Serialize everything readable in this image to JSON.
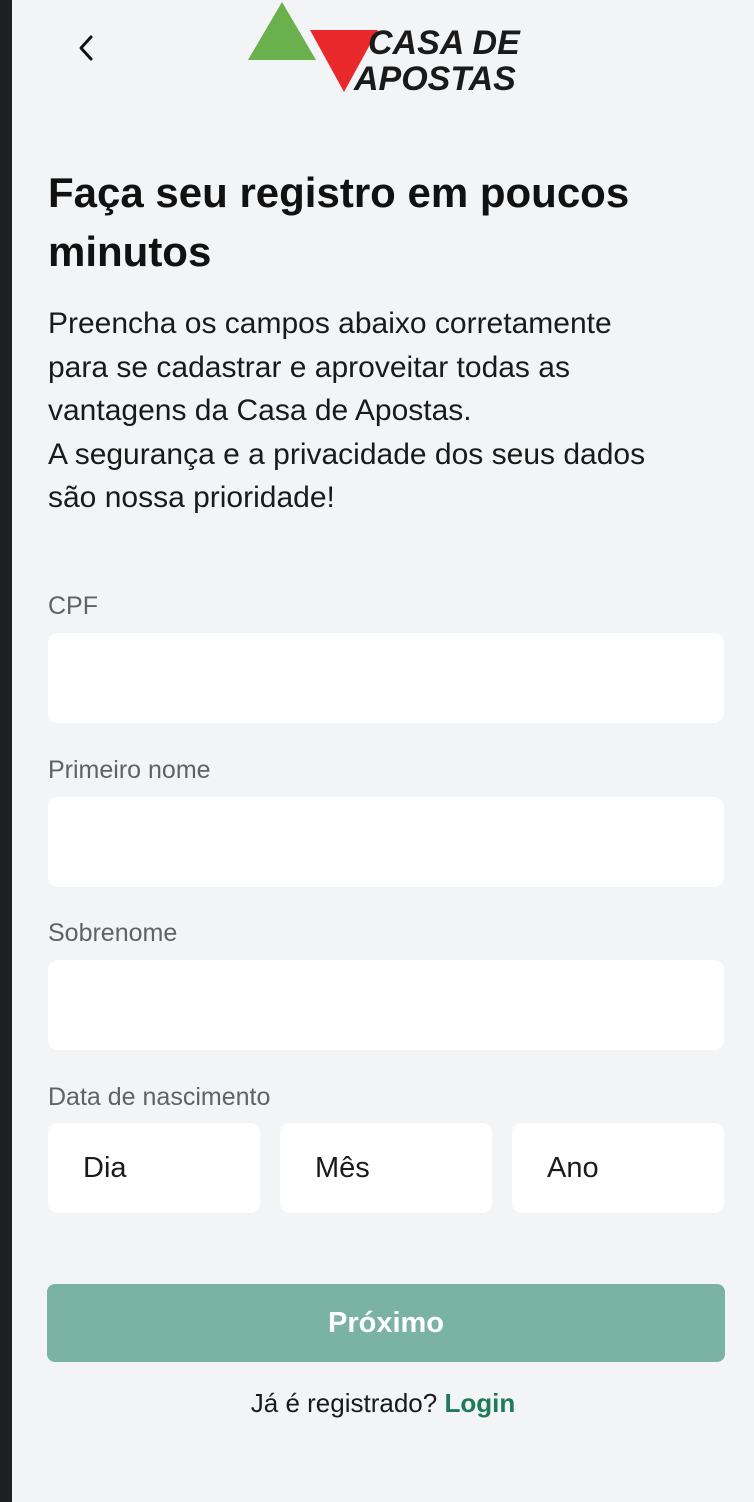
{
  "header": {
    "logo": {
      "line1": "CASA DE",
      "line2": "APOSTAS",
      "green": "#6ab04c",
      "red": "#e8282b"
    }
  },
  "main": {
    "title": "Faça seu registro em poucos minutos",
    "description": [
      "Preencha os campos abaixo corretamente",
      "para se cadastrar e aproveitar todas as",
      "vantagens da Casa de Apostas.",
      "A segurança e a privacidade dos seus dados",
      "são nossa prioridade!"
    ]
  },
  "form": {
    "cpf": {
      "label": "CPF",
      "value": ""
    },
    "first_name": {
      "label": "Primeiro nome",
      "value": ""
    },
    "last_name": {
      "label": "Sobrenome",
      "value": ""
    },
    "birthdate": {
      "label": "Data de nascimento",
      "day": "Dia",
      "month": "Mês",
      "year": "Ano"
    },
    "next_button": "Próximo"
  },
  "footer": {
    "prompt": "Já é registrado?",
    "login_link": "Login"
  },
  "colors": {
    "accent": "#1f7a5a",
    "button": "#7ab3a3",
    "background": "#f2f4f5"
  }
}
